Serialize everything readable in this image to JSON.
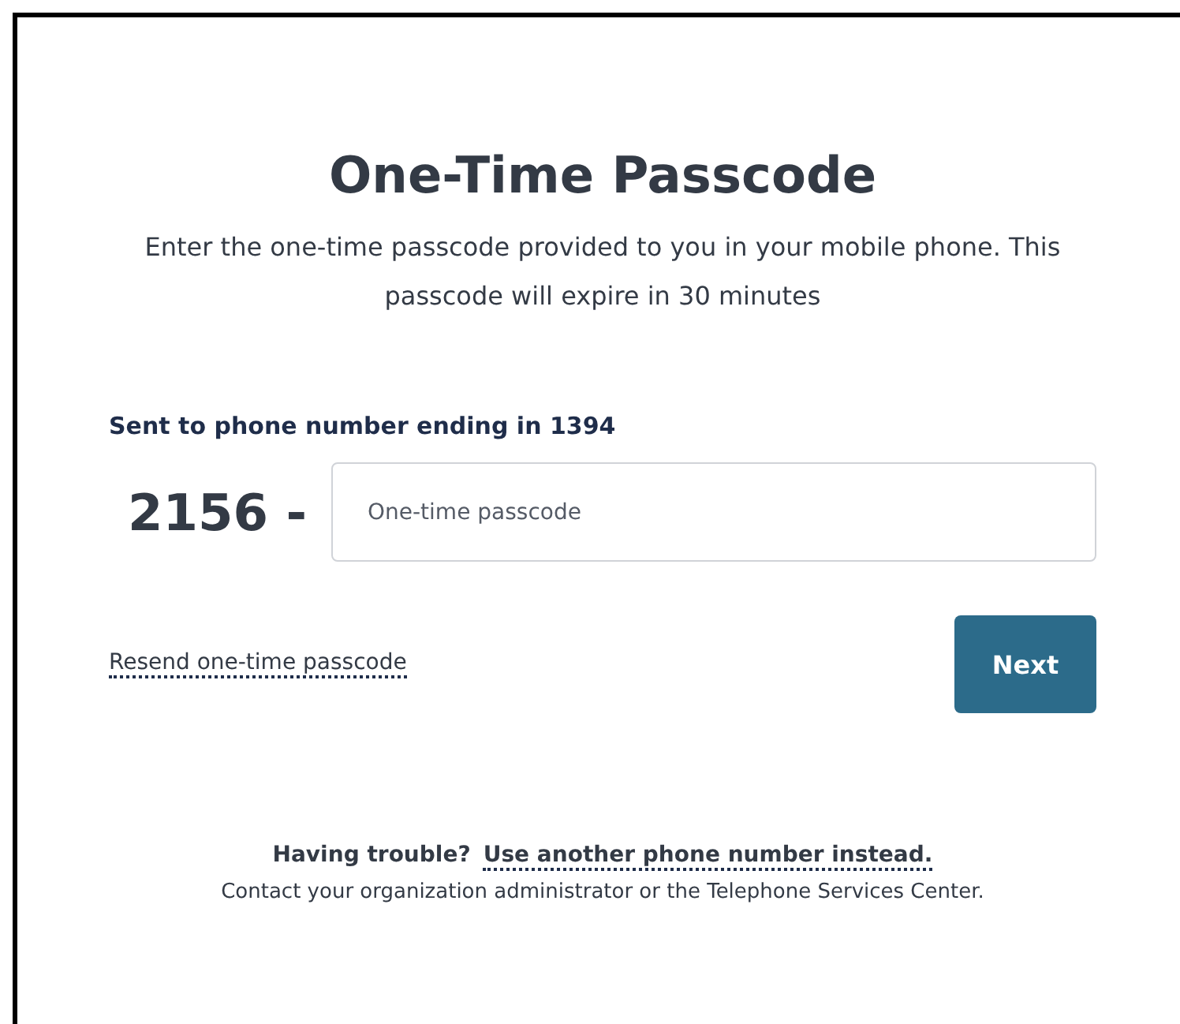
{
  "title": "One-Time Passcode",
  "description": "Enter the one-time passcode provided to you in your mobile phone. This passcode will expire in 30 minutes",
  "phone_label": "Sent to phone number ending in 1394",
  "prefix": "2156 -",
  "passcode_field": {
    "placeholder": "One-time passcode"
  },
  "resend_link": "Resend one-time passcode",
  "next_button": "Next",
  "trouble_text": "Having trouble?",
  "other_number_link": "Use another phone number instead.",
  "contact_text": "Contact your organization administrator or the Telephone Services Center."
}
